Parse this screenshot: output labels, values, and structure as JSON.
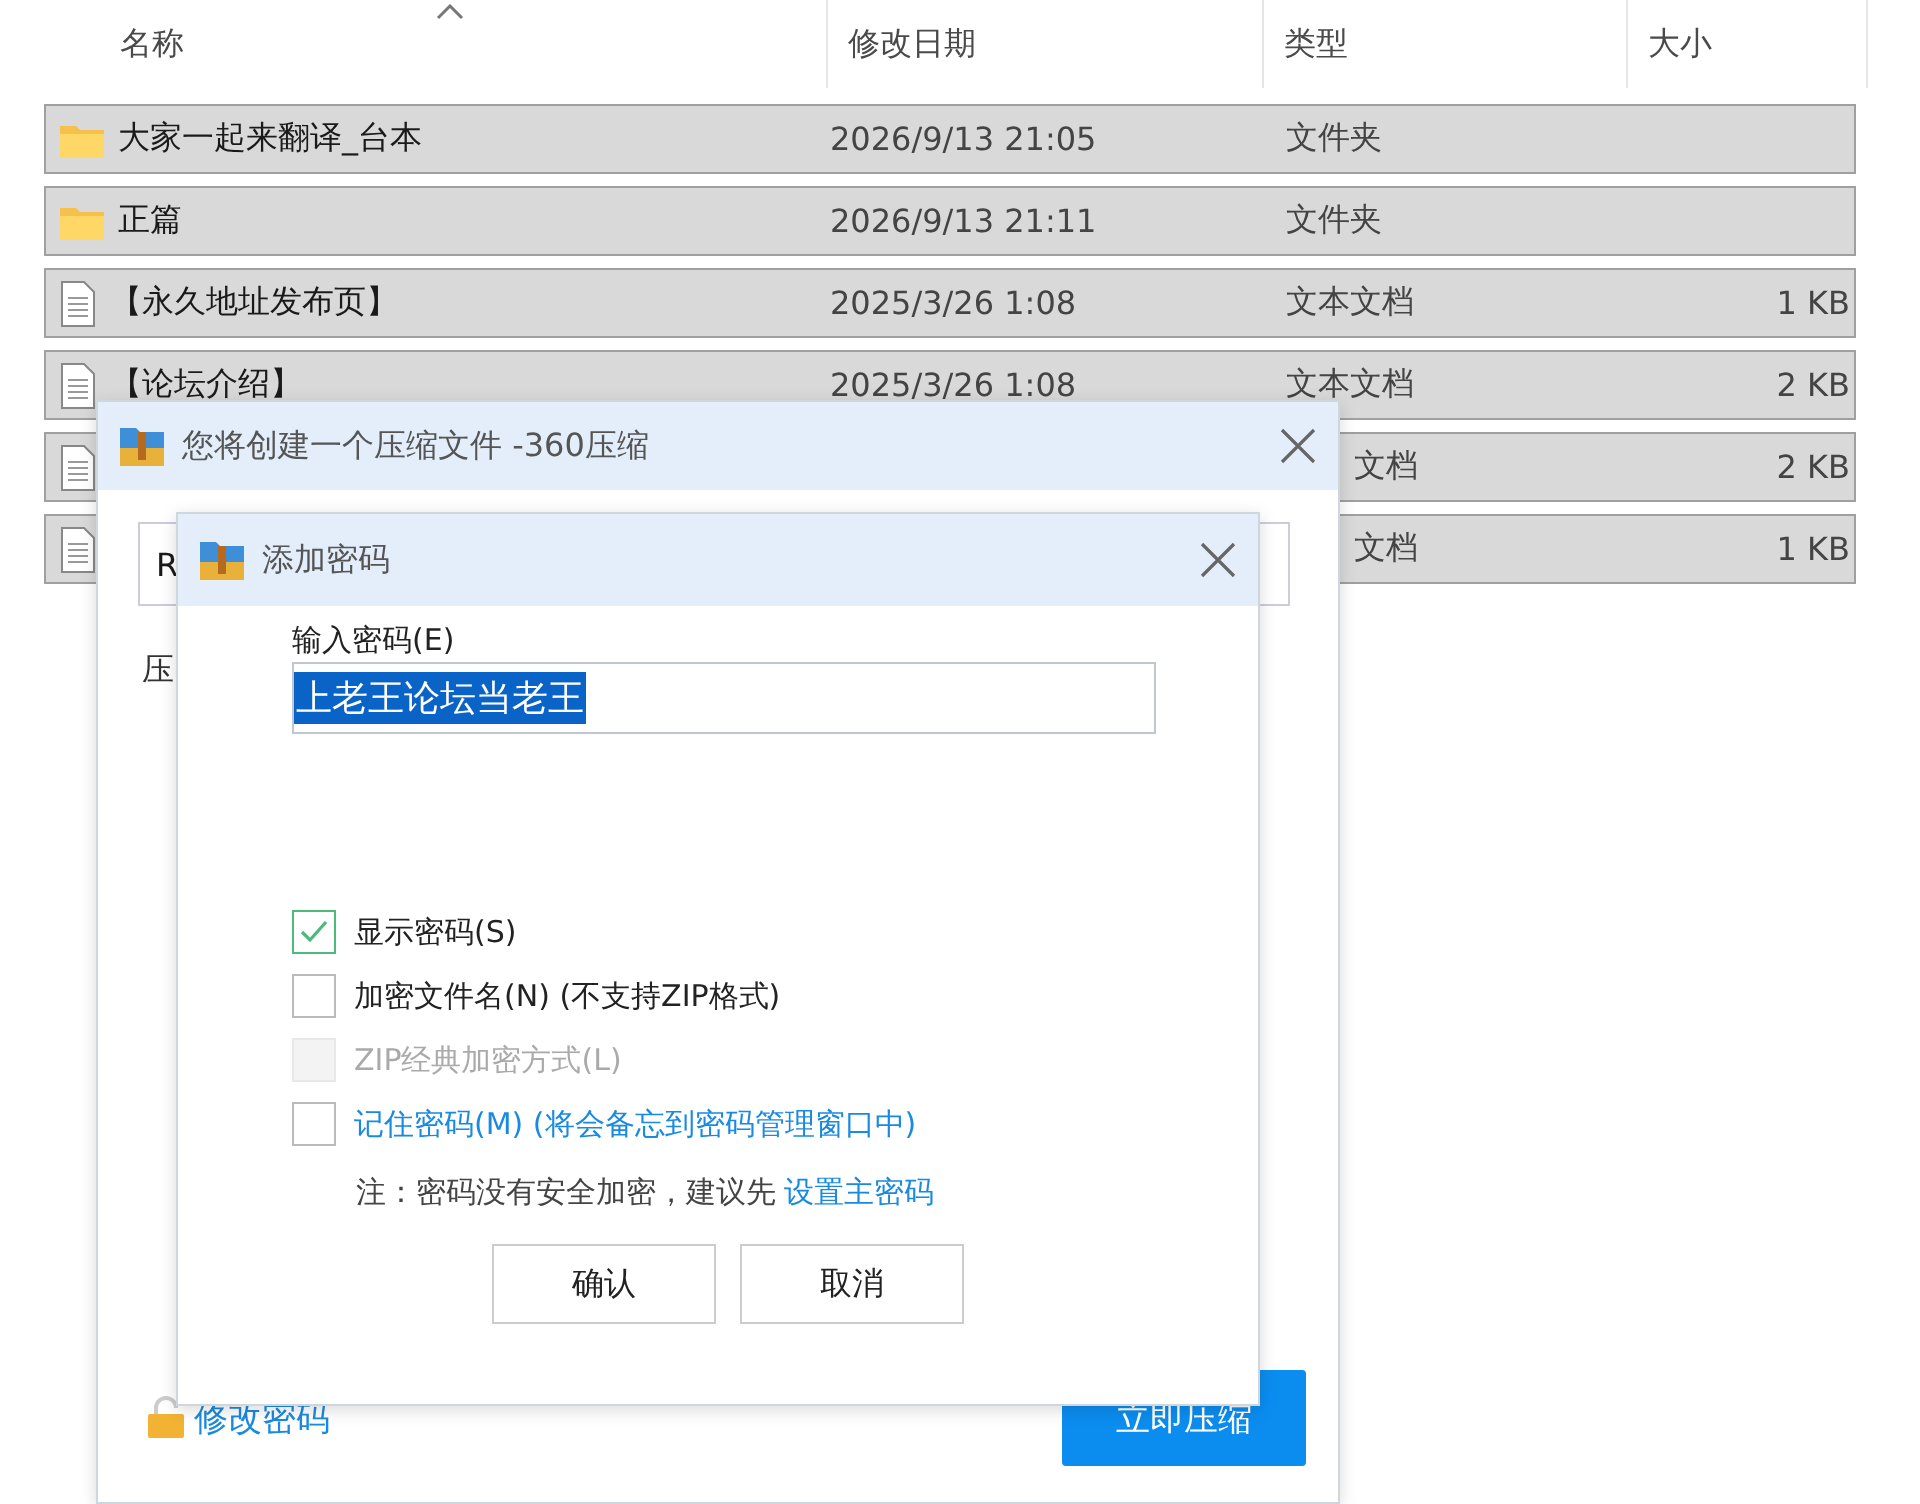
{
  "file_list": {
    "columns": [
      "名称",
      "修改日期",
      "类型",
      "大小"
    ],
    "rows": [
      {
        "kind": "folder",
        "name": "大家一起来翻译_台本",
        "date": "2026/9/13 21:05",
        "type": "文件夹",
        "selected": true
      },
      {
        "kind": "folder",
        "name": "正篇",
        "date": "2026/9/13 21:11",
        "type": "文件夹",
        "selected": true
      },
      {
        "kind": "text",
        "name": "【永久地址发布页】",
        "date": "2025/3/26 1:08",
        "type": "文本文档",
        "size": "1 KB",
        "selected": true
      },
      {
        "kind": "text",
        "name": "【论坛介绍】",
        "date": "2025/3/26 1:08",
        "type": "文本文档",
        "size": "2 KB",
        "selected": true
      },
      {
        "kind": "text",
        "type": "文档",
        "size": "2 KB",
        "selected": true
      },
      {
        "kind": "text",
        "type": "文档",
        "size": "1 KB",
        "selected": true
      }
    ]
  },
  "compress_dialog": {
    "title": "您将创建一个压缩文件 -360压缩",
    "path_value": "R",
    "label_fragment": "压",
    "change_password": "修改密码",
    "compress_button": "立即压缩"
  },
  "password_dialog": {
    "title": "添加密码",
    "field_label": "输入密码(E)",
    "password": "上老王论坛当老王",
    "options": [
      {
        "label": "显示密码(S)",
        "checked": true,
        "disabled": false,
        "link": false
      },
      {
        "label": "加密文件名(N) (不支持ZIP格式)",
        "checked": false,
        "disabled": false,
        "link": false
      },
      {
        "label": "ZIP经典加密方式(L)",
        "checked": false,
        "disabled": true,
        "link": false
      },
      {
        "label": "记住密码(M) (将会备忘到密码管理窗口中)",
        "checked": false,
        "disabled": false,
        "link": true
      }
    ],
    "note": "注：密码没有安全加密，建议先",
    "note_link": "设置主密码",
    "buttons": [
      "确认",
      "取消"
    ]
  }
}
